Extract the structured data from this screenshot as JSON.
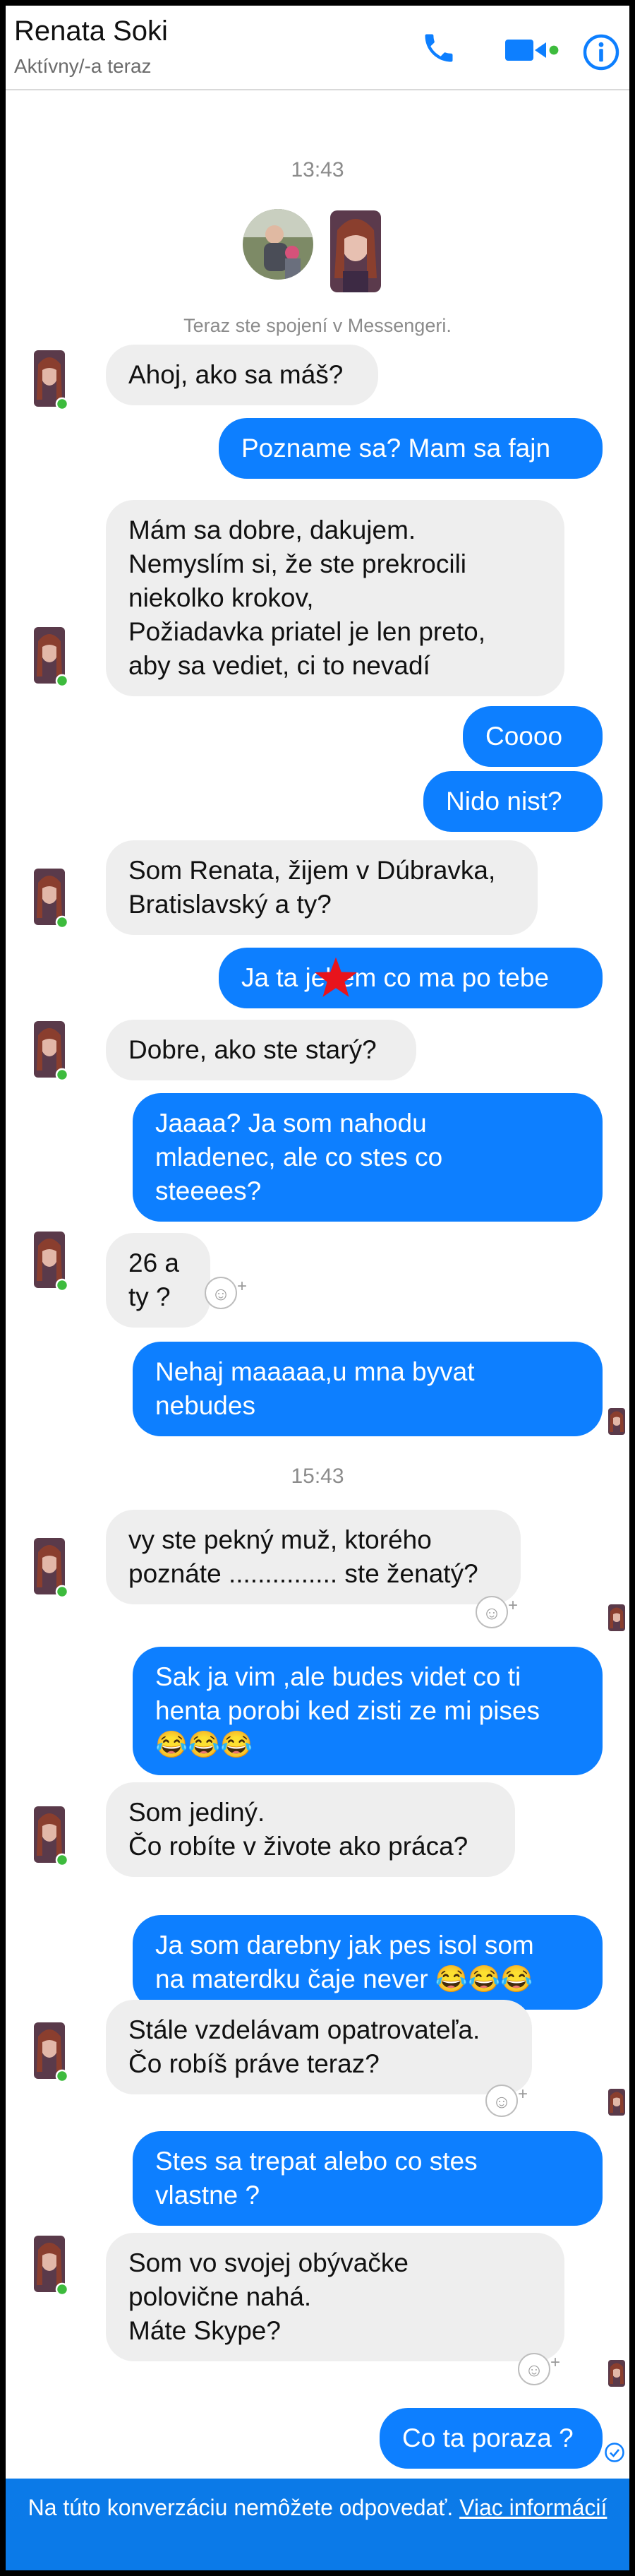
{
  "header": {
    "name": "Renata Soki",
    "status": "Aktívny/-a teraz",
    "icons": [
      "phone-icon",
      "video-camera-icon",
      "info-icon"
    ],
    "accent_color": "#0d7fff"
  },
  "thread": {
    "timestamp_1": "13:43",
    "timestamp_2": "15:43",
    "connected_text": "Teraz ste spojení v Messengeri.",
    "messages": [
      {
        "text": "Ahoj, ako sa máš?"
      },
      {
        "text": "Pozname sa? Mam sa fajn"
      },
      {
        "text": "Mám sa dobre, dakujem.\nNemyslím si, že ste prekrocili\nniekolko krokov,\nPožiadavka priatel je len preto,\naby sa vediet, ci to nevadí"
      },
      {
        "text": "Coooo"
      },
      {
        "text": "Nido nist?"
      },
      {
        "text": "Som Renata, žijem v Dúbravka,\nBratislavský a ty?"
      },
      {
        "text": "Ja ta jebem co ma po tebe"
      },
      {
        "text": "Dobre, ako ste starý?"
      },
      {
        "text": "Jaaaa? Ja som nahodu\nmladenec, ale co stes co\nsteeees?"
      },
      {
        "text": "26 a ty ?"
      },
      {
        "text": "Nehaj maaaaa,u mna byvat\nnebudes"
      },
      {
        "text": "vy ste pekný muž, ktorého\npoznáte ............... ste ženatý?"
      },
      {
        "text": "Sak ja vim ,ale budes videt co ti\nhenta porobi ked zisti ze mi pises\n😂😂😂"
      },
      {
        "text": "Som jediný.\nČo robíte v živote ako práca?"
      },
      {
        "text": "Ja som darebny jak pes isol som\nna materdku čaje never 😂😂😂"
      },
      {
        "text": "Stále vzdelávam opatrovateľa.\nČo robíš práve teraz?"
      },
      {
        "text": "Stes sa trepat alebo co stes\nvlastne ?"
      },
      {
        "text": "Som vo svojej obývačke\npolovične nahá.\nMáte Skype?"
      },
      {
        "text": "Co ta poraza ?"
      }
    ]
  },
  "footer": {
    "text": "Na túto konverzáciu nemôžete odpovedať.",
    "link": "Viac informácií"
  }
}
